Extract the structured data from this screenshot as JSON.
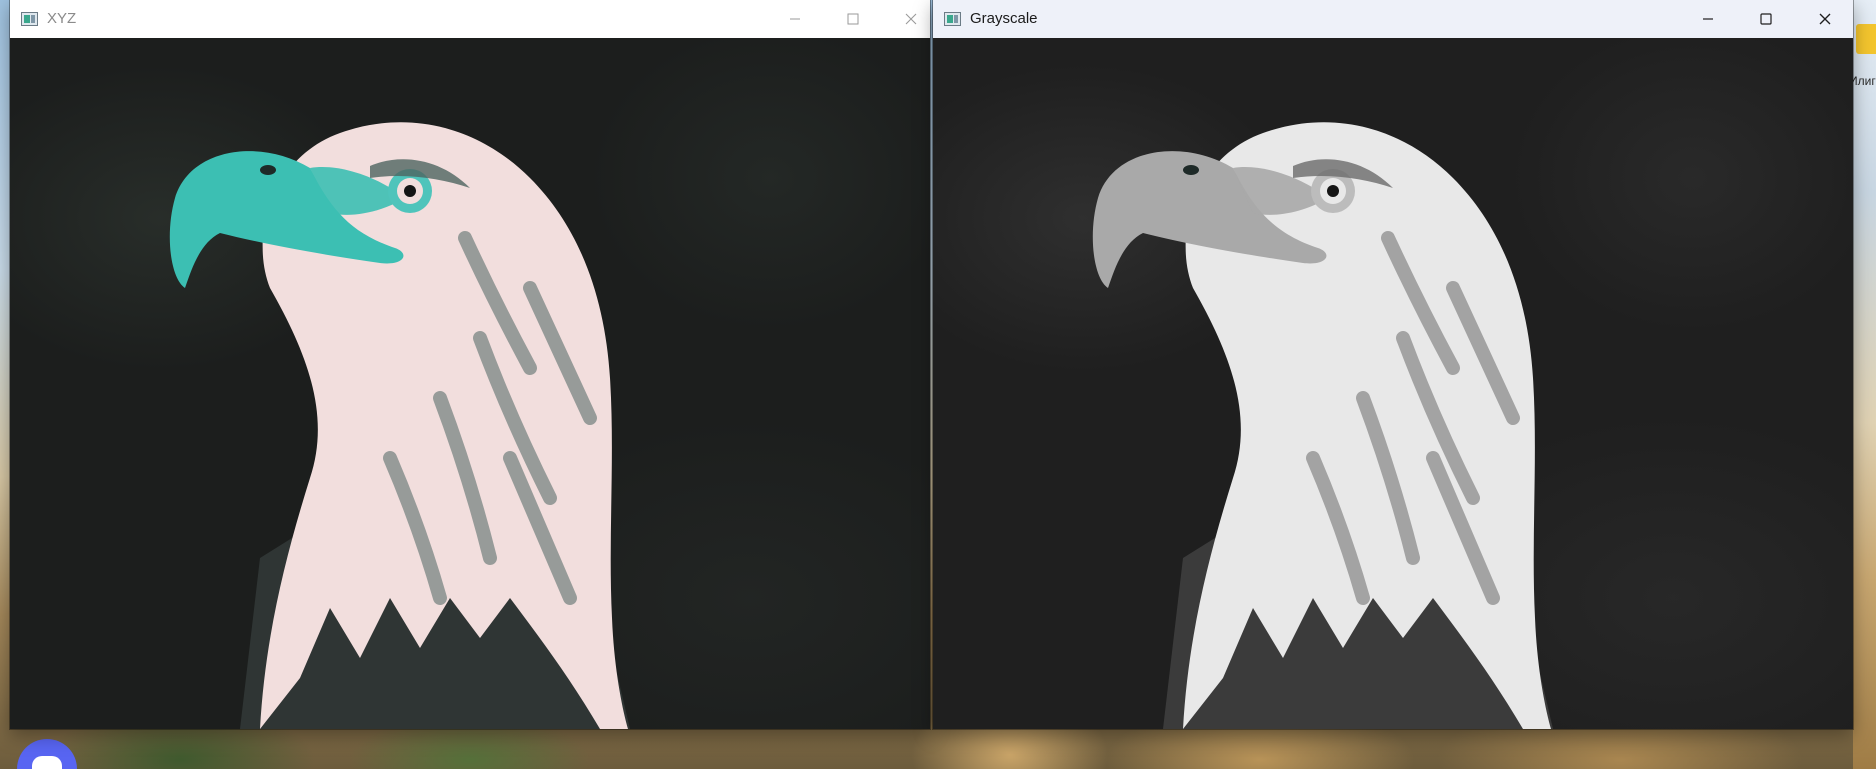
{
  "windows": [
    {
      "title": "XYZ",
      "image": "eagle-head-xyz-colorspace",
      "colors": {
        "beak": "#3cbfb3",
        "eye_ring": "#4fc4bb",
        "feathers": "#f2dedd",
        "shadow": "#4d6460",
        "body": "#2f3534"
      },
      "controls": {
        "minimize": "minimize-icon",
        "maximize": "maximize-icon",
        "close": "close-icon"
      }
    },
    {
      "title": "Grayscale",
      "image": "eagle-head-grayscale",
      "colors": {
        "beak": "#a9a9a9",
        "eye_ring": "#bcbcbc",
        "feathers": "#e8e8e8",
        "shadow": "#6a6a6a",
        "body": "#3b3b3b"
      },
      "controls": {
        "minimize": "minimize-icon",
        "maximize": "maximize-icon",
        "close": "close-icon"
      }
    }
  ],
  "desktop": {
    "edge_text": "Илиг",
    "taskbar_app": "discord-icon"
  }
}
